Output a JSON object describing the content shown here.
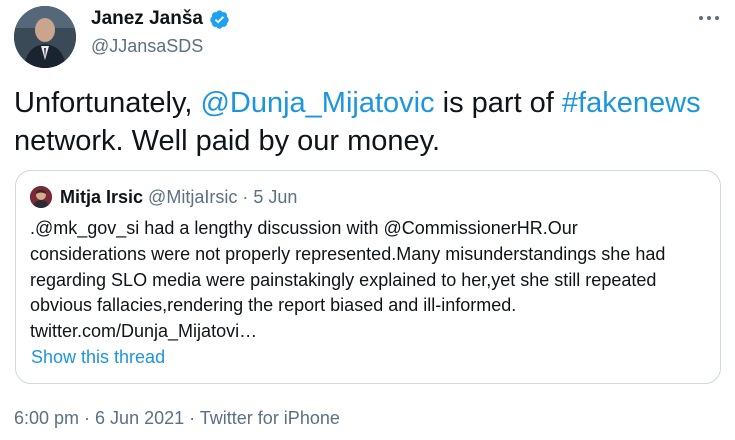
{
  "author": {
    "name": "Janez Janša",
    "handle": "@JJansaSDS",
    "verified_icon": "verified-badge-icon",
    "accent": "#1da1f2"
  },
  "tweet": {
    "text_parts": [
      "Unfortunately, ",
      "@Dunja_Mijatovic",
      " is part of ",
      "#fakenews",
      " network. Well paid by our money."
    ],
    "link_color": "#1b95e0"
  },
  "quote": {
    "author_name": "Mitja Irsic",
    "author_handle": "@MitjaIrsic",
    "separator": " · ",
    "date": "5 Jun",
    "lines": [
      ".@mk_gov_si had a lengthy discussion with @CommissionerHR.Our",
      "considerations were not properly represented.Many misunderstandings she had",
      "regarding SLO media were painstakingly explained to her,yet she still repeated",
      "obvious fallacies,rendering the report biased and ill-informed.",
      "twitter.com/Dunja_Mijatovi…"
    ],
    "show_thread": "Show this thread"
  },
  "footer": {
    "time": "6:00 pm",
    "separator1": " · ",
    "date": "6 Jun 2021",
    "separator2": " · ",
    "source": "Twitter for iPhone"
  },
  "icons": {
    "more": "more-horizontal-icon"
  }
}
